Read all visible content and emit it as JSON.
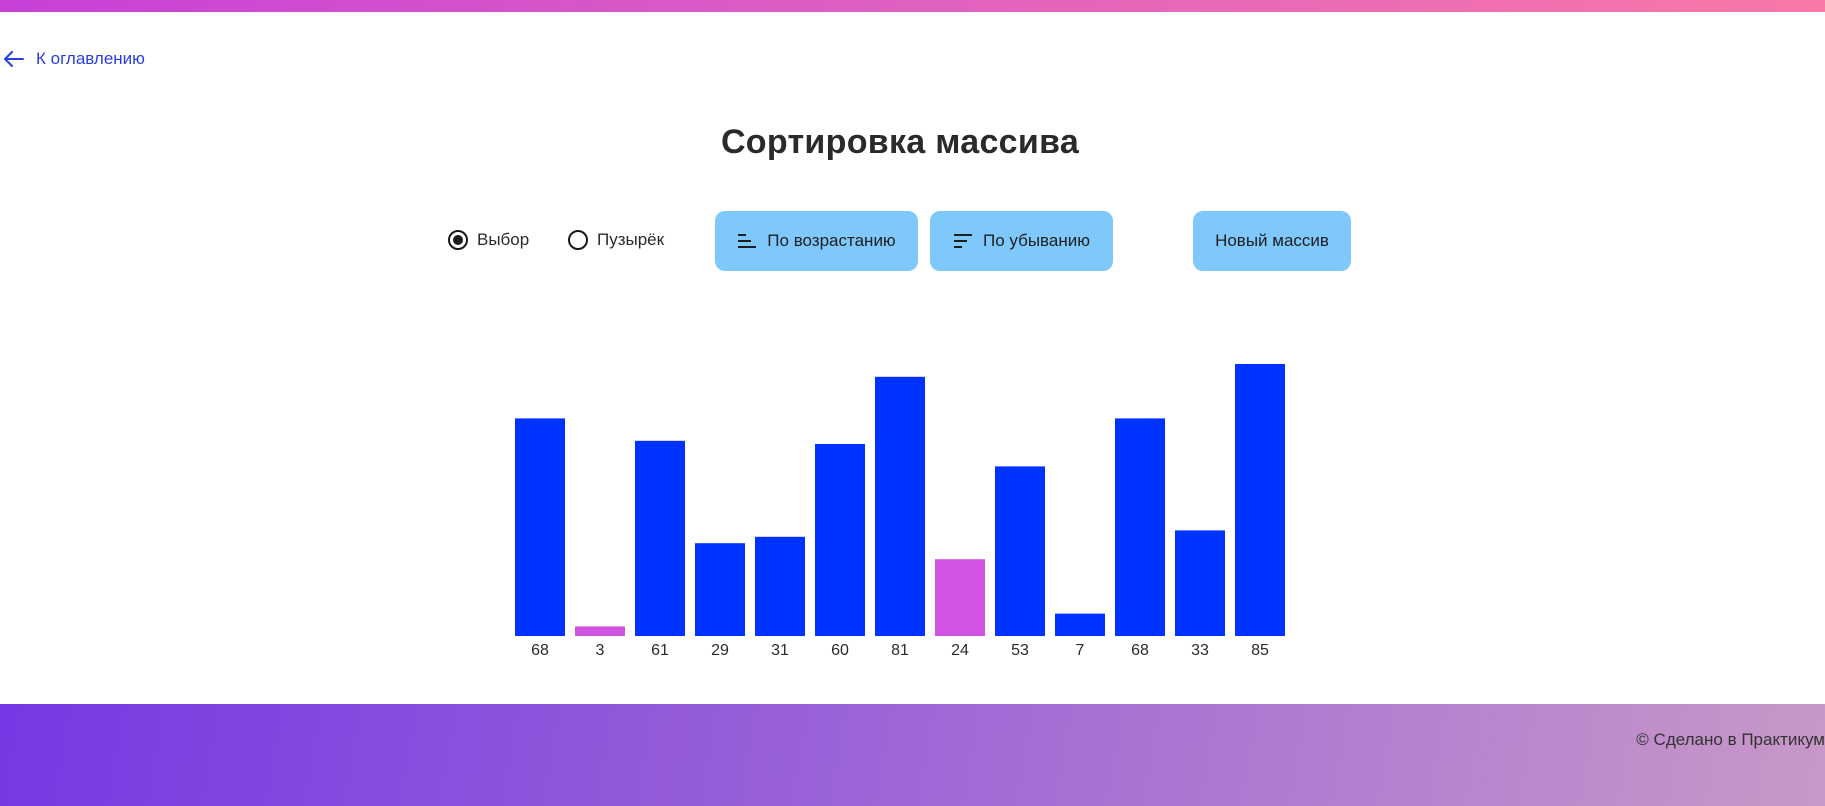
{
  "nav": {
    "back_label": "К оглавлению"
  },
  "header": {
    "title": "Сортировка массива"
  },
  "controls": {
    "radios": [
      {
        "label": "Выбор",
        "checked": true
      },
      {
        "label": "Пузырёк",
        "checked": false
      }
    ],
    "ascending_label": "По возрастанию",
    "descending_label": "По убыванию",
    "new_array_label": "Новый массив"
  },
  "colors": {
    "accent": "#2a3fe0",
    "bar_default": "#0032ff",
    "bar_changing": "#d252e1",
    "button_bg": "#7fc8fc"
  },
  "chart_data": {
    "type": "bar",
    "categories": [
      "68",
      "3",
      "61",
      "29",
      "31",
      "60",
      "81",
      "24",
      "53",
      "7",
      "68",
      "33",
      "85"
    ],
    "values": [
      68,
      3,
      61,
      29,
      31,
      60,
      81,
      24,
      53,
      7,
      68,
      33,
      85
    ],
    "states": [
      "default",
      "changing",
      "default",
      "default",
      "default",
      "default",
      "default",
      "changing",
      "default",
      "default",
      "default",
      "default",
      "default"
    ],
    "title": "",
    "xlabel": "",
    "ylabel": "",
    "ylim": [
      0,
      100
    ],
    "grid": false
  },
  "footer": {
    "copyright": "© Сделано в Практикум"
  }
}
